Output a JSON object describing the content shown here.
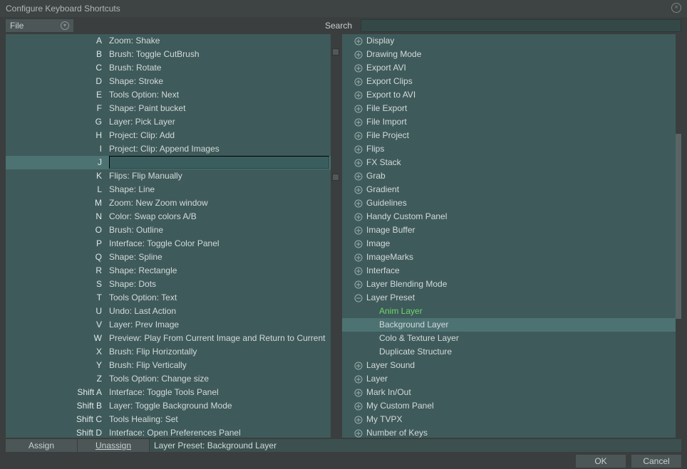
{
  "title": "Configure Keyboard Shortcuts",
  "file_label": "File",
  "search_label": "Search",
  "search_value": "",
  "selected_key": "J",
  "left_rows": [
    {
      "key": "A",
      "action": "Zoom: Shake"
    },
    {
      "key": "B",
      "action": "Brush: Toggle CutBrush"
    },
    {
      "key": "C",
      "action": "Brush: Rotate"
    },
    {
      "key": "D",
      "action": "Shape: Stroke"
    },
    {
      "key": "E",
      "action": "Tools Option: Next"
    },
    {
      "key": "F",
      "action": "Shape: Paint bucket"
    },
    {
      "key": "G",
      "action": "Layer: Pick Layer"
    },
    {
      "key": "H",
      "action": "Project: Clip: Add"
    },
    {
      "key": "I",
      "action": "Project: Clip: Append Images"
    },
    {
      "key": "J",
      "action": "",
      "selected": true
    },
    {
      "key": "K",
      "action": "Flips: Flip Manually"
    },
    {
      "key": "L",
      "action": "Shape: Line"
    },
    {
      "key": "M",
      "action": "Zoom: New Zoom window"
    },
    {
      "key": "N",
      "action": "Color: Swap colors A/B"
    },
    {
      "key": "O",
      "action": "Brush: Outline"
    },
    {
      "key": "P",
      "action": "Interface: Toggle Color Panel"
    },
    {
      "key": "Q",
      "action": "Shape: Spline"
    },
    {
      "key": "R",
      "action": "Shape: Rectangle"
    },
    {
      "key": "S",
      "action": "Shape: Dots"
    },
    {
      "key": "T",
      "action": "Tools Option: Text"
    },
    {
      "key": "U",
      "action": "Undo: Last Action"
    },
    {
      "key": "V",
      "action": "Layer: Prev Image"
    },
    {
      "key": "W",
      "action": "Preview: Play From Current Image and Return to Current"
    },
    {
      "key": "X",
      "action": "Brush: Flip Horizontally"
    },
    {
      "key": "Y",
      "action": "Brush: Flip Vertically"
    },
    {
      "key": "Z",
      "action": "Tools Option: Change size"
    },
    {
      "key": "Shift A",
      "action": "Interface: Toggle Tools Panel"
    },
    {
      "key": "Shift B",
      "action": "Layer: Toggle Background Mode"
    },
    {
      "key": "Shift C",
      "action": "Tools Healing: Set"
    },
    {
      "key": "Shift D",
      "action": "Interface: Open Preferences Panel"
    }
  ],
  "right_rows": [
    {
      "label": "Display",
      "expand": "plus"
    },
    {
      "label": "Drawing Mode",
      "expand": "plus"
    },
    {
      "label": "Export AVI",
      "expand": "plus"
    },
    {
      "label": "Export Clips",
      "expand": "plus"
    },
    {
      "label": "Export to AVI",
      "expand": "plus"
    },
    {
      "label": "File Export",
      "expand": "plus"
    },
    {
      "label": "File Import",
      "expand": "plus"
    },
    {
      "label": "File Project",
      "expand": "plus"
    },
    {
      "label": "Flips",
      "expand": "plus"
    },
    {
      "label": "FX Stack",
      "expand": "plus"
    },
    {
      "label": "Grab",
      "expand": "plus"
    },
    {
      "label": "Gradient",
      "expand": "plus"
    },
    {
      "label": "Guidelines",
      "expand": "plus"
    },
    {
      "label": "Handy Custom Panel",
      "expand": "plus"
    },
    {
      "label": "Image Buffer",
      "expand": "plus"
    },
    {
      "label": "Image",
      "expand": "plus"
    },
    {
      "label": "ImageMarks",
      "expand": "plus"
    },
    {
      "label": "Interface",
      "expand": "plus"
    },
    {
      "label": "Layer Blending Mode",
      "expand": "plus"
    },
    {
      "label": "Layer Preset",
      "expand": "minus",
      "children": [
        {
          "label": "Anim Layer",
          "active": true
        },
        {
          "label": "Background Layer",
          "selected": true
        },
        {
          "label": "Colo & Texture Layer"
        },
        {
          "label": "Duplicate Structure"
        }
      ]
    },
    {
      "label": "Layer Sound",
      "expand": "plus"
    },
    {
      "label": "Layer",
      "expand": "plus"
    },
    {
      "label": "Mark In/Out",
      "expand": "plus"
    },
    {
      "label": "My Custom Panel",
      "expand": "plus"
    },
    {
      "label": "My TVPX",
      "expand": "plus"
    },
    {
      "label": "Number of Keys",
      "expand": "plus"
    }
  ],
  "assign_label": "Assign",
  "unassign_label": "Unassign",
  "assign_field": "Layer Preset: Background Layer",
  "ok_label": "OK",
  "cancel_label": "Cancel"
}
